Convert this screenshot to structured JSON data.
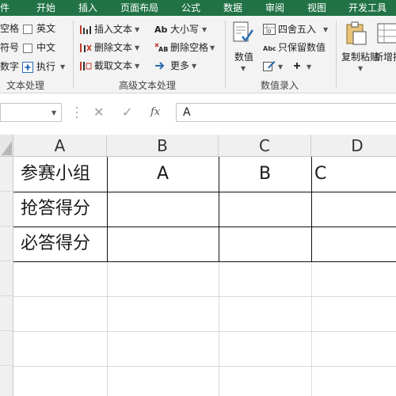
{
  "tabs": [
    "件",
    "开始",
    "插入",
    "页面布局",
    "公式",
    "数据",
    "审阅",
    "视图",
    "开发工具"
  ],
  "ribbon": {
    "group_text": {
      "label": "文本处理",
      "items": [
        "空格",
        "符号",
        "数字",
        "英文",
        "中文",
        "执行"
      ]
    },
    "group_adv": {
      "label": "高级文本处理",
      "insert_text": "插入文本",
      "delete_text": "删除文本",
      "extract_text": "截取文本",
      "case": "大小写",
      "delete_space": "删除空格",
      "more": "更多"
    },
    "group_data": {
      "label": "数值录入",
      "value_button": "数值",
      "round": "四舍五入",
      "keep_value": "只保留数值"
    },
    "copy_paste": "复制粘贴",
    "add_insert": "新增插"
  },
  "formula_bar": {
    "fx": "fx",
    "value": "A"
  },
  "columns": [
    "A",
    "B",
    "C",
    "D"
  ],
  "cells": {
    "a1": "参赛小组",
    "b1": "A",
    "c1": "B",
    "d1": "C",
    "a2": "抢答得分",
    "a3": "必答得分"
  },
  "colors": {
    "accent": "#217346"
  }
}
